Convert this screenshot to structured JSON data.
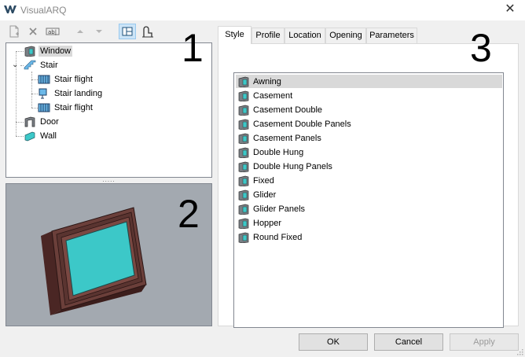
{
  "window": {
    "title": "VisualARQ",
    "close_glyph": "✕"
  },
  "toolbar": {
    "buttons": [
      {
        "icon": "new-page-icon"
      },
      {
        "icon": "delete-icon"
      },
      {
        "icon": "rename-icon"
      },
      {
        "icon": "move-up-icon"
      },
      {
        "icon": "move-down-icon"
      },
      {
        "icon": "tree-view-icon",
        "active": true
      },
      {
        "icon": "hierarchy-icon"
      }
    ]
  },
  "tree": {
    "items": [
      {
        "label": "Window",
        "selected": true
      },
      {
        "label": "Stair",
        "expanded": true
      },
      {
        "label": "Stair flight"
      },
      {
        "label": "Stair landing"
      },
      {
        "label": "Stair flight"
      },
      {
        "label": "Door"
      },
      {
        "label": "Wall"
      }
    ]
  },
  "splitter": {
    "dots": "....."
  },
  "callouts": {
    "one": "1",
    "two": "2",
    "three": "3"
  },
  "tabs": [
    "Style",
    "Profile",
    "Location",
    "Opening",
    "Parameters"
  ],
  "active_tab": "Style",
  "styles": [
    "Awning",
    "Casement",
    "Casement Double",
    "Casement Double Panels",
    "Casement Panels",
    "Double Hung",
    "Double Hung Panels",
    "Fixed",
    "Glider",
    "Glider Panels",
    "Hopper",
    "Round Fixed"
  ],
  "selected_style": "Awning",
  "buttons": {
    "ok": "OK",
    "cancel": "Cancel",
    "apply": "Apply"
  },
  "colors": {
    "preview_bg": "#a3a9b0",
    "frame": "#6b3f3a",
    "glass": "#3cc8c8",
    "selection": "#d9d9d9",
    "active_tool": "#cce4f7"
  }
}
